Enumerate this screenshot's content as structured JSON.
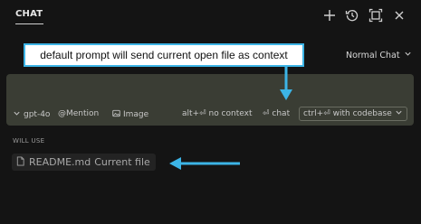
{
  "header": {
    "tab_label": "CHAT",
    "icons": [
      "plus-icon",
      "history-icon",
      "maximize-icon",
      "close-icon"
    ]
  },
  "mode": {
    "selected": "Normal Chat"
  },
  "callout": {
    "text": "default prompt will send current open file as context"
  },
  "toolbar": {
    "model": "gpt-4o",
    "mention": "@Mention",
    "image": "Image",
    "no_context": "alt+⏎ no context",
    "chat": "⏎ chat",
    "codebase": "ctrl+⏎ with codebase"
  },
  "context": {
    "label": "WILL USE",
    "file_name": "README.md",
    "file_note": "Current file"
  },
  "colors": {
    "accent": "#3cb4e6",
    "input_bg": "#3a3d34",
    "background": "#141414"
  }
}
